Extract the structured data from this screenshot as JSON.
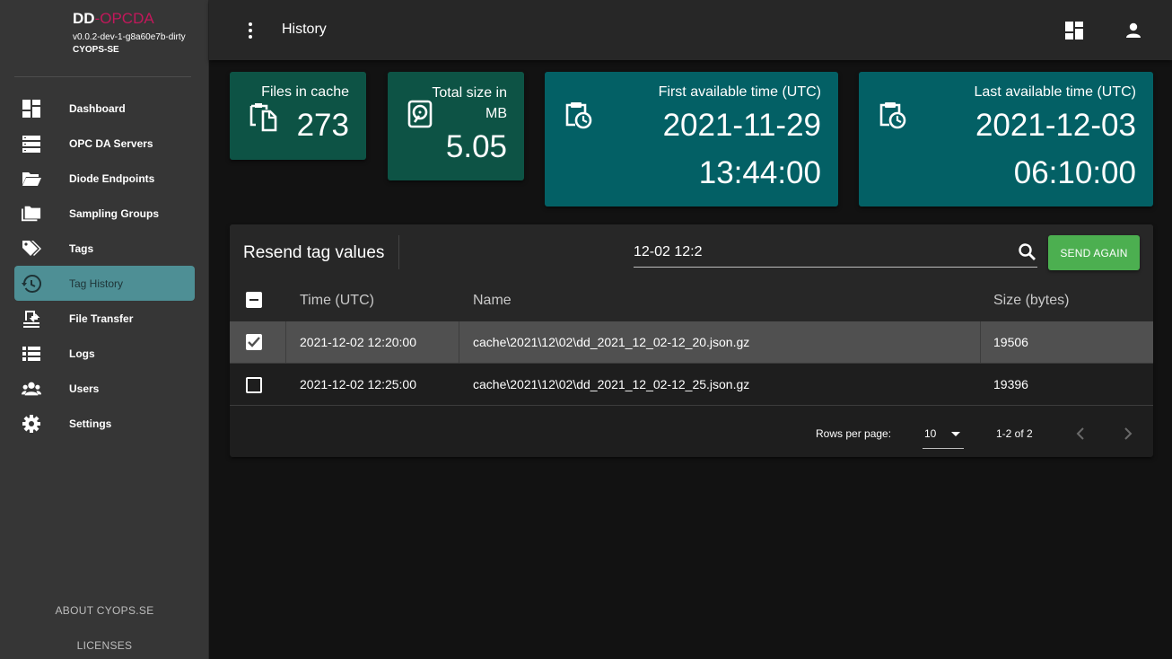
{
  "brand": {
    "name": "DD",
    "suffix": "-OPCDA",
    "version": "v0.0.2-dev-1-g8a60e7b-dirty",
    "org": "CYOPS-SE"
  },
  "sidebar": {
    "items": [
      {
        "label": "Dashboard",
        "icon": "dashboard-icon"
      },
      {
        "label": "OPC DA Servers",
        "icon": "servers-icon"
      },
      {
        "label": "Diode Endpoints",
        "icon": "folder-open-icon"
      },
      {
        "label": "Sampling Groups",
        "icon": "folders-icon"
      },
      {
        "label": "Tags",
        "icon": "tags-icon"
      },
      {
        "label": "Tag History",
        "icon": "history-icon",
        "active": true
      },
      {
        "label": "File Transfer",
        "icon": "file-transfer-icon"
      },
      {
        "label": "Logs",
        "icon": "list-icon"
      },
      {
        "label": "Users",
        "icon": "users-icon"
      },
      {
        "label": "Settings",
        "icon": "gear-icon"
      }
    ],
    "footer_about": "ABOUT CYOPS.SE",
    "footer_licenses": "LICENSES"
  },
  "topbar": {
    "title": "History",
    "icons": [
      "more-vert-icon",
      "dashboard-layout-icon",
      "account-icon"
    ]
  },
  "stats": {
    "files": {
      "label": "Files in cache",
      "value": "273",
      "icon": "file-copy-icon"
    },
    "size": {
      "label_line1": "Total size in",
      "label_line2": "MB",
      "value": "5.05",
      "icon": "harddisk-icon"
    },
    "first": {
      "label": "First available time (UTC)",
      "date": "2021-11-29",
      "time": "13:44:00",
      "icon": "clipboard-clock-icon"
    },
    "last": {
      "label": "Last available time (UTC)",
      "date": "2021-12-03",
      "time": "06:10:00",
      "icon": "clipboard-clock-icon"
    }
  },
  "resend": {
    "title": "Resend tag values",
    "search_value": "12-02 12:2",
    "send_label": "SEND AGAIN",
    "columns": {
      "time": "Time (UTC)",
      "name": "Name",
      "size": "Size (bytes)"
    },
    "rows": [
      {
        "checked": true,
        "time": "2021-12-02 12:20:00",
        "name": "cache\\2021\\12\\02\\dd_2021_12_02-12_20.json.gz",
        "size": "19506"
      },
      {
        "checked": false,
        "time": "2021-12-02 12:25:00",
        "name": "cache\\2021\\12\\02\\dd_2021_12_02-12_25.json.gz",
        "size": "19396"
      }
    ],
    "pagination": {
      "rows_per_page_label": "Rows per page:",
      "rows_per_page": "10",
      "range": "1-2 of 2"
    }
  },
  "colors": {
    "card_green": "#0d5345",
    "card_teal": "#036065",
    "active_nav": "#4e8f95",
    "send_button": "#4caf50",
    "brand_accent": "#c2185b"
  }
}
